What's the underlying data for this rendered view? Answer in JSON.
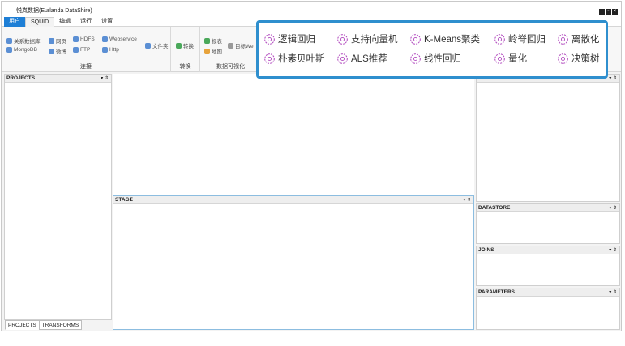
{
  "window": {
    "title": "悦岚数据(Eurlanda DataShire)"
  },
  "menu": {
    "tabs": [
      "用户",
      "SQUID",
      "编辑",
      "运行",
      "设置"
    ]
  },
  "ribbon": {
    "connect": {
      "label": "连接",
      "items": [
        "关系数据库",
        "网页",
        "HDFS",
        "Webservice",
        "文件夹",
        "MongoDB",
        "微博",
        "FTP",
        "Http"
      ]
    },
    "convert": {
      "label": "转换",
      "items": [
        "转换"
      ]
    },
    "visualize": {
      "label": "数据可视化",
      "items": [
        "报表",
        "目标We",
        "地图"
      ]
    }
  },
  "ml_algorithms": [
    "逻辑回归",
    "支持向量机",
    "K-Means聚类",
    "岭脊回归",
    "离散化",
    "朴素贝叶斯",
    "ALS推荐",
    "线性回归",
    "量化",
    "决策树"
  ],
  "panels": {
    "projects": "PROJECTS",
    "stage": "STAGE",
    "datastore": "DATASTORE",
    "joins": "JOINS",
    "parameters": "PARAMETERS"
  },
  "bottom_tabs": [
    "PROJECTS",
    "TRANSFORMS"
  ],
  "colors": {
    "accent": "#2f8fce",
    "active_tab": "#1e7fd6",
    "icon_purple": "#b24cbf"
  }
}
